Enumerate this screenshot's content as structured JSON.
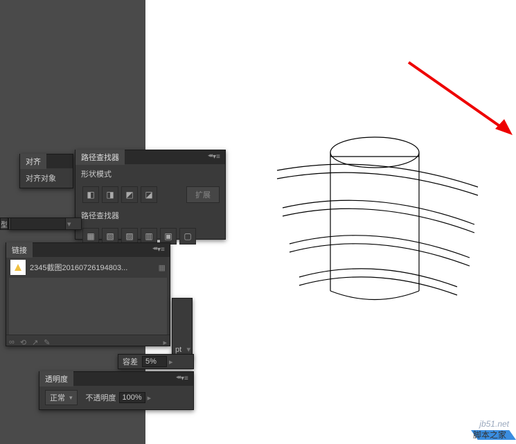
{
  "align_panel": {
    "tab": "对齐",
    "section": "对齐对象"
  },
  "pathfinder_panel": {
    "tab": "路径查找器",
    "shape_modes": "形状模式",
    "expand": "扩展",
    "pathfinders": "路径查找器"
  },
  "links_panel": {
    "tab": "链接",
    "item": "2345截图20160726194803...",
    "row_icons": [
      "∞",
      "⟲",
      "↗",
      "✎"
    ]
  },
  "type_strip": {
    "label": "型"
  },
  "tolerance_panel": {
    "label": "容差",
    "value": "5%"
  },
  "other_strip": {
    "pt": "pt"
  },
  "transparency_panel": {
    "tab": "透明度",
    "mode": "正常",
    "opacity_label": "不透明度",
    "opacity_value": "100%"
  },
  "watermark": "jb51.net",
  "footer": "脚本之家"
}
